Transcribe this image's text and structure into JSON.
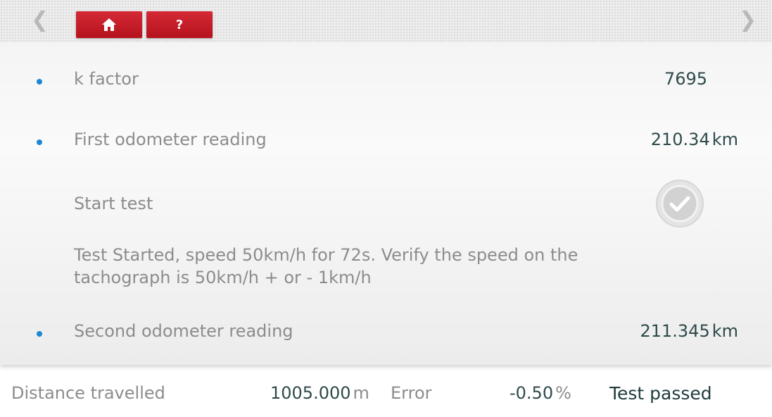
{
  "header": {
    "back_icon": "chevron-left-icon",
    "forward_icon": "chevron-right-icon",
    "home_icon": "home-icon",
    "help_label": "?",
    "button_color": "#c41a25"
  },
  "rows": {
    "k_factor": {
      "label": "k factor",
      "value": "7695"
    },
    "first_odometer": {
      "label": "First odometer reading",
      "value": "210.34",
      "unit": "km"
    },
    "start_test": {
      "label": "Start test",
      "status_icon": "checkmark-circle-icon"
    },
    "message": "Test Started, speed 50km/h for 72s. Verify the speed on the tachograph is 50km/h + or - 1km/h",
    "second_odometer": {
      "label": "Second odometer reading",
      "value": "211.345",
      "unit": "km"
    }
  },
  "footer": {
    "distance_label": "Distance travelled",
    "distance_value": "1005.000",
    "distance_unit": "m",
    "error_label": "Error",
    "error_value": "-0.50",
    "error_unit": "%",
    "result": "Test passed"
  },
  "colors": {
    "bullet": "#1c88d1",
    "label": "#8c8c8c",
    "value": "#2f4a4a"
  }
}
